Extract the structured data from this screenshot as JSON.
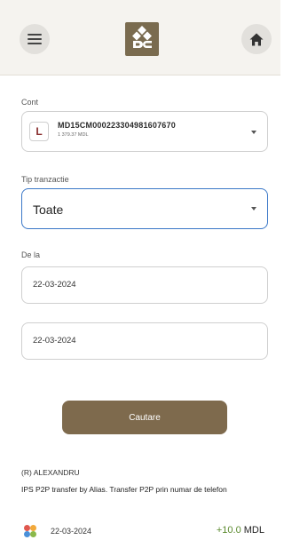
{
  "header": {
    "menu_icon": "hamburger-menu-icon",
    "logo_icon": "bank-logo-icon",
    "home_icon": "home-icon"
  },
  "form": {
    "account": {
      "label": "Cont",
      "avatar_letter": "L",
      "number": "MD15CM000223304981607670",
      "balance": "1 379.37 MDL"
    },
    "transaction_type": {
      "label": "Tip tranzactie",
      "value": "Toate"
    },
    "date_from": {
      "label": "De la",
      "value": "22-03-2024"
    },
    "date_to": {
      "value": "22-03-2024"
    },
    "search_button": "Cautare"
  },
  "transactions": [
    {
      "name": "(R) ALEXANDRU",
      "description": "IPS P2P transfer by Alias. Transfer P2P prin numar de telefon",
      "date": "22-03-2024",
      "amount": "+10.0",
      "currency": "MDL",
      "icon": "p2p-transfer-icon",
      "amount_color": "#5b8a2e"
    }
  ],
  "colors": {
    "brand": "#7e6a4d",
    "focus_border": "#3b78c8",
    "header_bg": "#f5f3ef"
  }
}
